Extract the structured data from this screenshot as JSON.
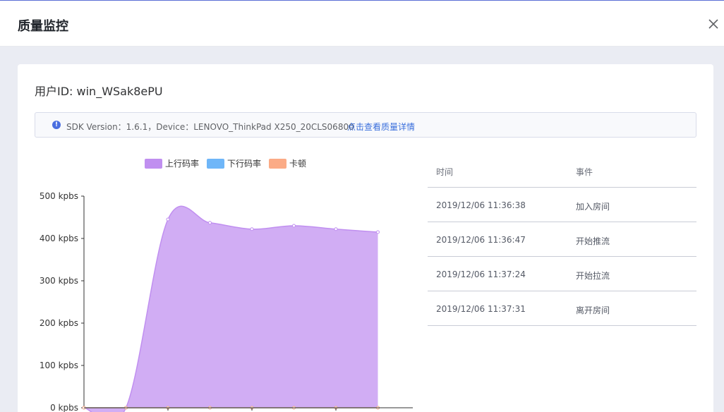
{
  "dialog": {
    "title": "质量监控"
  },
  "card": {
    "user_id_label": "用户ID: win_WSak8ePU",
    "info_bar": {
      "text": "SDK Version：1.6.1，Device：LENOVO_ThinkPad X250_20CLS06800",
      "link_label": "点击查看质量详情"
    }
  },
  "legend": [
    {
      "label": "上行码率",
      "color": "#c08ff0"
    },
    {
      "label": "下行码率",
      "color": "#6fb6f8"
    },
    {
      "label": "卡顿",
      "color": "#fbab86"
    }
  ],
  "chart_data": {
    "type": "area",
    "ylim": [
      0,
      500
    ],
    "y_ticks": [
      "500 kpbs",
      "400 kpbs",
      "300 kpbs",
      "200 kpbs",
      "100 kpbs",
      "0 kpbs"
    ],
    "series": [
      {
        "name": "上行码率",
        "values": [
          0,
          0,
          445,
          437,
          422,
          430,
          422,
          415
        ],
        "color": "#c08ff0"
      },
      {
        "name": "下行码率",
        "values": [
          0,
          0,
          0,
          0,
          0,
          0,
          0,
          0
        ],
        "color": "#6fb6f8"
      },
      {
        "name": "卡顿",
        "values": [
          0,
          0,
          0,
          0,
          0,
          0,
          0,
          0
        ],
        "color": "#fbab86"
      }
    ]
  },
  "events": {
    "headers": {
      "time": "时间",
      "event": "事件"
    },
    "rows": [
      {
        "time": "2019/12/06 11:36:38",
        "event": "加入房间"
      },
      {
        "time": "2019/12/06 11:36:47",
        "event": "开始推流"
      },
      {
        "time": "2019/12/06 11:37:24",
        "event": "开始拉流"
      },
      {
        "time": "2019/12/06 11:37:31",
        "event": "离开房间"
      }
    ]
  }
}
